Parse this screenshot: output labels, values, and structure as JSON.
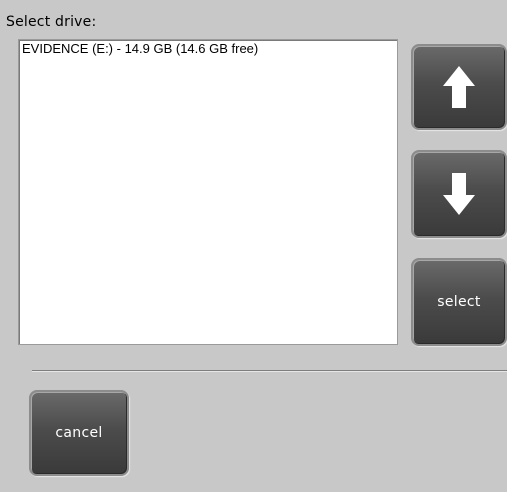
{
  "dialog": {
    "title": "Select drive:"
  },
  "drive_list": {
    "items": [
      {
        "label": "EVIDENCE (E:) - 14.9 GB (14.6 GB free)"
      }
    ]
  },
  "buttons": {
    "up_icon": "arrow-up-icon",
    "down_icon": "arrow-down-icon",
    "select_label": "select",
    "cancel_label": "cancel"
  },
  "colors": {
    "background": "#c8c8c8",
    "button_face": "#4c4c4c",
    "list_background": "#ffffff"
  }
}
